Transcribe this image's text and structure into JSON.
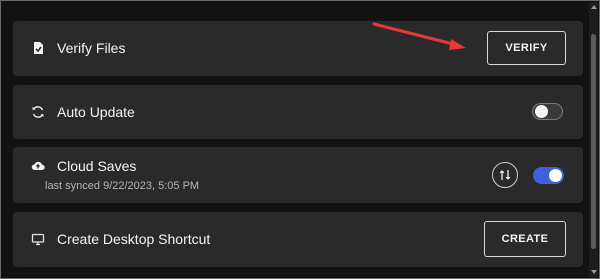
{
  "colors": {
    "background": "#121212",
    "row_background": "#2a2a2a",
    "accent": "#3e5fe0",
    "annotation_arrow": "#e8393a"
  },
  "settings": {
    "verify": {
      "label": "Verify Files",
      "button_label": "VERIFY",
      "icon": "file-check-icon"
    },
    "auto_update": {
      "label": "Auto Update",
      "icon": "refresh-icon",
      "enabled": false
    },
    "cloud_saves": {
      "label": "Cloud Saves",
      "last_synced": "last synced 9/22/2023, 5:05 PM",
      "icon": "cloud-upload-icon",
      "sync_icon": "sync-icon",
      "enabled": true
    },
    "desktop_shortcut": {
      "label": "Create Desktop Shortcut",
      "button_label": "CREATE",
      "icon": "monitor-icon"
    }
  }
}
